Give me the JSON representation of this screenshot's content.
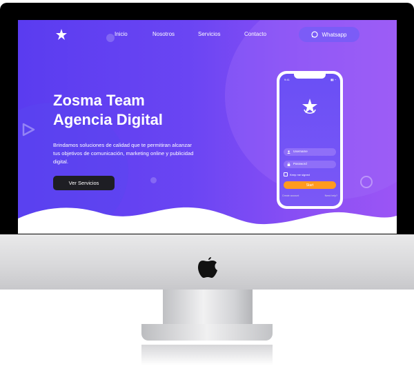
{
  "nav": {
    "items": [
      "Inicio",
      "Nosotros",
      "Servicios",
      "Contacto"
    ],
    "whatsapp_label": "Whatsapp"
  },
  "hero": {
    "title_line1": "Zosma Team",
    "title_line2": "Agencia Digital",
    "description": "Brindamos soluciones de calidad que te permitiran alcanzar tus objetivos de comunicación, marketing online y publicidad digital.",
    "cta_label": "Ver Servicios"
  },
  "phone": {
    "time": "9:41",
    "username_placeholder": "Username",
    "password_placeholder": "Password",
    "remember_label": "Keep me signed",
    "start_label": "Start",
    "left_link": "Create account",
    "right_link": "Need help?"
  },
  "colors": {
    "gradient_start": "#5a3cf0",
    "gradient_end": "#9b55f5",
    "cta_bg": "#1e1e24",
    "start_btn": "#ff9a1f"
  },
  "icons": [
    "zosma-logo-icon",
    "whatsapp-icon",
    "apple-logo-icon",
    "user-icon",
    "lock-icon",
    "play-triangle-icon"
  ]
}
